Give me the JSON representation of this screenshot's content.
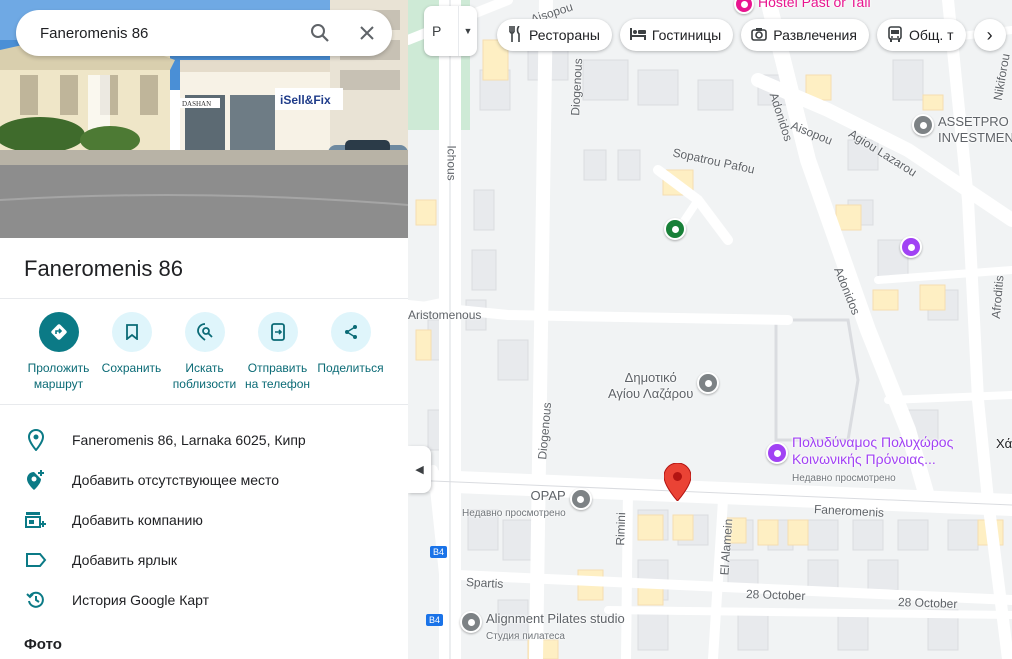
{
  "search": {
    "query": "Faneromenis 86"
  },
  "place": {
    "title": "Faneromenis 86"
  },
  "actions": [
    {
      "line1": "Проложить",
      "line2": "маршрут"
    },
    {
      "line1": "Сохранить",
      "line2": ""
    },
    {
      "line1": "Искать",
      "line2": "поблизости"
    },
    {
      "line1": "Отправить",
      "line2": "на телефон"
    },
    {
      "line1": "Поделиться",
      "line2": ""
    }
  ],
  "info": {
    "address": "Faneromenis 86, Larnaka 6025, Кипр",
    "add_place": "Добавить отсутствующее место",
    "add_business": "Добавить компанию",
    "add_label": "Добавить ярлык",
    "history": "История Google Карт"
  },
  "photos_section": "Фото",
  "map": {
    "layer_button": "Р",
    "chips": [
      {
        "label": "Рестораны",
        "icon": "fork-knife-icon"
      },
      {
        "label": "Гостиницы",
        "icon": "bed-icon"
      },
      {
        "label": "Развлечения",
        "icon": "camera-icon"
      },
      {
        "label": "Общ. т",
        "icon": "bus-icon"
      }
    ],
    "streets": {
      "aisopou_top": "Aisopou",
      "diogenous_top": "Diogenous",
      "adonidos_top": "Adonidos",
      "aisopou": "Aisopou",
      "agiou_lazarou": "Agiou Lazarou",
      "nikiforou": "Nikiforou",
      "ichous": "Ichous",
      "sopatrou_pafou": "Sopatrou Pafou",
      "adonidos": "Adonidos",
      "afroditis": "Afroditis",
      "aristomenous": "Aristomenous",
      "diogenous": "Diogenous",
      "faneromenis": "Faneromenis",
      "rimini": "Rimini",
      "el_alamein": "El Alamein",
      "spartis": "Spartis",
      "october1": "28 October",
      "october2": "28 October",
      "b4a": "B4",
      "b4b": "B4",
      "hai": "Χάι"
    },
    "pois": {
      "hostel": "Hostel Past or Tail",
      "assetpro_1": "ASSETPRO",
      "assetpro_2": "INVESTMEN",
      "school_1": "Δημοτικό",
      "school_2": "Αγίου Λαζάρου",
      "hall_1": "Πολυδύναμος Πολυχώρος",
      "hall_2": "Κοινωνικής Πρόνοιας...",
      "hall_sub": "Недавно просмотрено",
      "opap": "OPAP",
      "opap_sub": "Недавно просмотрено",
      "pilates": "Alignment Pilates studio",
      "pilates_sub": "Студия пилатеса"
    }
  }
}
